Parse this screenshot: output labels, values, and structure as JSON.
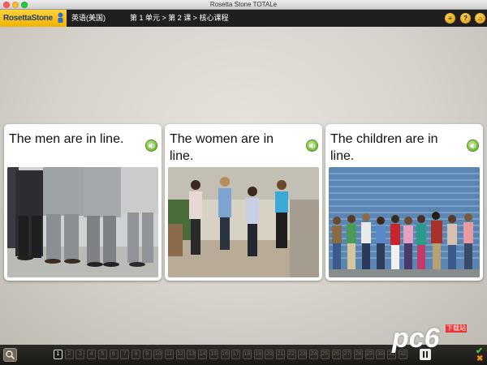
{
  "window": {
    "title": "Rosetta Stone TOTALe"
  },
  "header": {
    "logo_text": "RosettaStone",
    "language": "英语(美国)",
    "breadcrumb": "第 1 单元 > 第 2 课 > 核心课程",
    "icons": [
      "list-icon",
      "help-icon",
      "home-icon"
    ]
  },
  "cards": [
    {
      "text": "The men are in line.",
      "image": "men-in-line-photo"
    },
    {
      "text": "The women are in line.",
      "image": "women-in-line-photo"
    },
    {
      "text": "The children are in line.",
      "image": "children-in-line-photo"
    }
  ],
  "progress": {
    "current": 1,
    "steps": [
      "1",
      "2",
      "3",
      "4",
      "5",
      "6",
      "7",
      "8",
      "9",
      "10",
      "11",
      "12",
      "13",
      "14",
      "15",
      "16",
      "17",
      "18",
      "19",
      "20",
      "21",
      "22",
      "23",
      "24",
      "25",
      "26",
      "27",
      "28",
      "29",
      "30",
      "31",
      "32"
    ]
  },
  "watermark": {
    "text": "pc6",
    "badge": "下载站"
  },
  "colors": {
    "accent": "#f2b300",
    "speaker": "#5aa81e",
    "bar": "#1f1f1f"
  }
}
